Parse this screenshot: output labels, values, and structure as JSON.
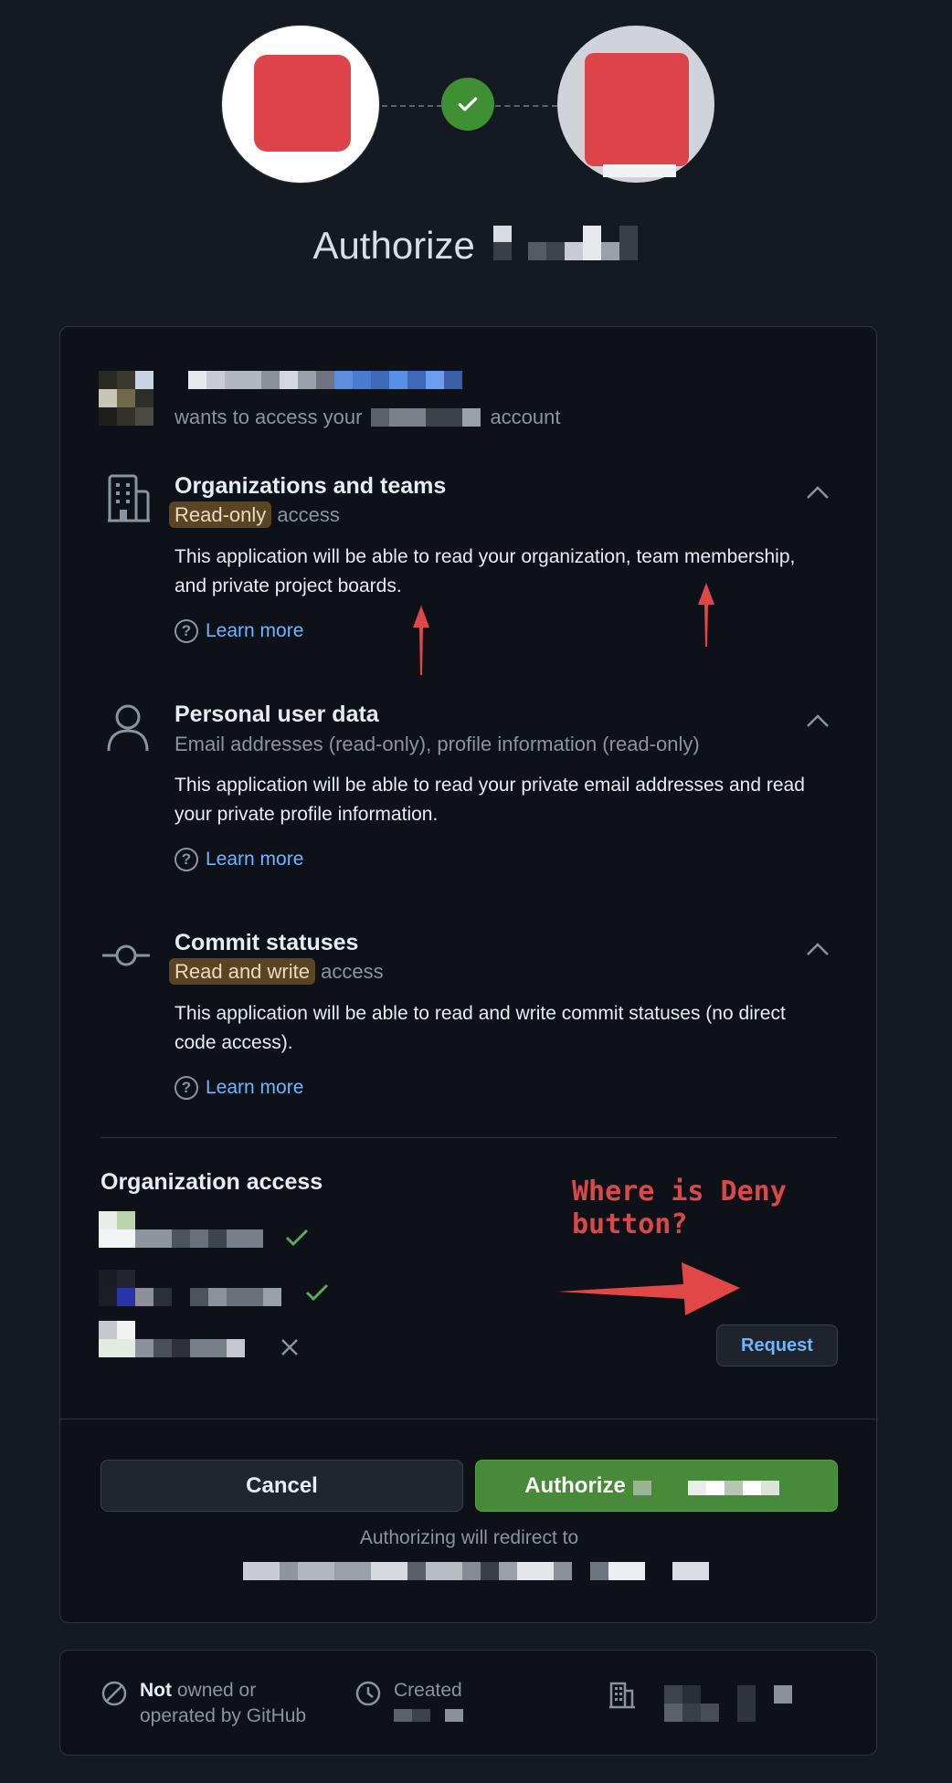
{
  "header": {
    "title_prefix": "Authorize",
    "colors": {
      "app_red": "#dc4449",
      "success": "#3f8f33"
    }
  },
  "request": {
    "wants_access_prefix": "wants to access your",
    "wants_access_suffix": "account"
  },
  "permissions": [
    {
      "title": "Organizations and teams",
      "badge": "Read-only",
      "badge_suffix": "access",
      "description": "This application will be able to read your organization, team membership, and private project boards.",
      "learn_more": "Learn more",
      "icon": "organization-icon"
    },
    {
      "title": "Personal user data",
      "subtitle": "Email addresses (read-only), profile information (read-only)",
      "description": "This application will be able to read your private email addresses and read your private profile information.",
      "learn_more": "Learn more",
      "icon": "person-icon"
    },
    {
      "title": "Commit statuses",
      "badge": "Read and write",
      "badge_suffix": "access",
      "description": "This application will be able to read and write commit statuses (no direct code access).",
      "learn_more": "Learn more",
      "icon": "commit-icon"
    }
  ],
  "org_access": {
    "title": "Organization access",
    "items": [
      {
        "status": "granted"
      },
      {
        "status": "granted"
      },
      {
        "status": "denied"
      }
    ],
    "request_button": "Request"
  },
  "annotation": {
    "text_line1": "Where is Deny",
    "text_line2": "button?",
    "color": "#d84a4a"
  },
  "actions": {
    "cancel": "Cancel",
    "authorize_prefix": "Authorize",
    "redirect_text": "Authorizing will redirect to"
  },
  "footer": {
    "not_bold": "Not",
    "not_rest_line1": "owned or",
    "not_rest_line2": "operated by GitHub",
    "created": "Created"
  }
}
